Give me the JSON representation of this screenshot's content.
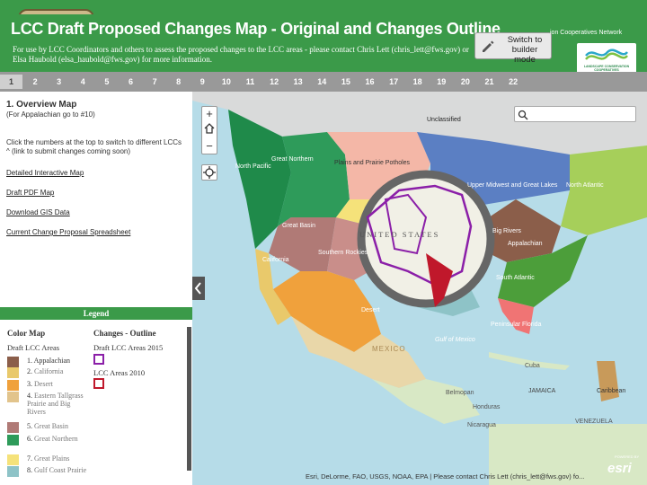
{
  "header": {
    "title": "LCC Draft Proposed Changes Map - Original and Changes Outline",
    "subtitle": "For use by LCC Coordinators and others to assess the proposed changes to the LCC areas - please contact Chris Lett (chris_lett@fws.gov) or Elsa Haubold (elsa_haubold@fws.gov) for more information.",
    "switch_button": "Switch to builder mode",
    "network_label": "ion Cooperatives Network",
    "logo_text": "LANDSCAPE CONSERVATION COOPERATIVES"
  },
  "tabs": [
    "1",
    "2",
    "3",
    "4",
    "5",
    "6",
    "7",
    "8",
    "9",
    "10",
    "11",
    "12",
    "13",
    "14",
    "15",
    "16",
    "17",
    "18",
    "19",
    "20",
    "21",
    "22"
  ],
  "active_tab": "1",
  "panel": {
    "heading": "1. Overview Map",
    "note": "(For Appalachian go to #10)",
    "instructions": "Click the numbers at the top to switch to different LCCs ^ (link to submit changes coming soon)",
    "links": [
      "Detailed Interactive Map",
      "Draft PDF Map",
      "Download GIS Data",
      "Current Change Proposal Spreadsheet"
    ]
  },
  "legend": {
    "title": "Legend",
    "col1_header": "Color Map",
    "col1_sub": "Draft LCC Areas",
    "col2_header": "Changes - Outline",
    "outline_items": [
      {
        "label": "Draft LCC Areas 2015",
        "color": "#8b1fa8"
      },
      {
        "label": "LCC Areas 2010",
        "color": "#c0182b"
      }
    ],
    "items": [
      {
        "num": "1.",
        "name": "Appalachian",
        "color": "#8b5e4a"
      },
      {
        "num": "2.",
        "name": "California",
        "color": "#e9c96b"
      },
      {
        "num": "3.",
        "name": "Desert",
        "color": "#f0a13c"
      },
      {
        "num": "4.",
        "name": "Eastern Tallgrass Prairie and Big Rivers",
        "color": "#e2c48c"
      },
      {
        "num": "5.",
        "name": "Great Basin",
        "color": "#b07a76"
      },
      {
        "num": "6.",
        "name": "Great Northern",
        "color": "#2e9b5a"
      },
      {
        "num": "7.",
        "name": "Great Plains",
        "color": "#f5e27a"
      },
      {
        "num": "8.",
        "name": "Gulf Coast Prairie",
        "color": "#8ec3c7"
      }
    ]
  },
  "map": {
    "labels": [
      "Unclassified",
      "Great Northern",
      "North Pacific",
      "Plains and Prairie Potholes",
      "Upper Midwest and Great Lakes",
      "North Atlantic",
      "Great Basin",
      "California",
      "Southern Rockies",
      "Appalachian",
      "Big Rivers",
      "South Atlantic",
      "Desert",
      "Peninsular Florida",
      "Gulf of Mexico",
      "UNITED STATES",
      "MEXICO",
      "Honduras",
      "JAMAICA",
      "Caribbean",
      "VENEZUELA",
      "Belmopan",
      "Nicaragua",
      "Cuba"
    ],
    "attribution": "Esri, DeLorme, FAO, USGS, NOAA, EPA | Please contact Chris Lett (chris_lett@fws.gov) fo..."
  },
  "colors": {
    "header_green": "#3b9a49",
    "tab_gray": "#999999",
    "ocean": "#b6dce8"
  }
}
